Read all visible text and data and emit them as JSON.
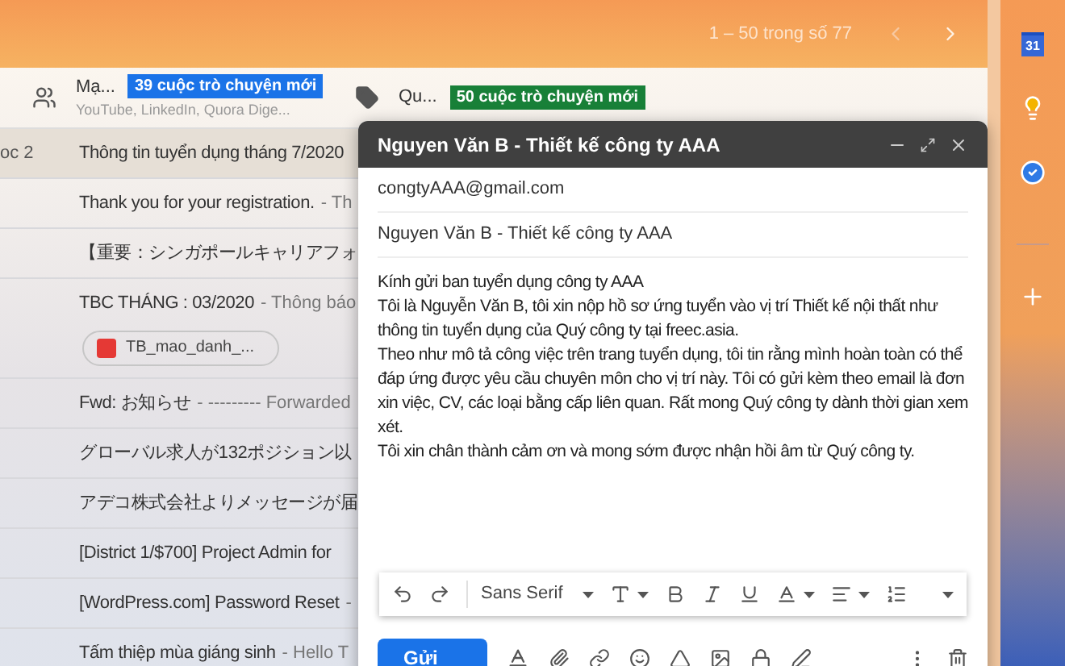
{
  "top_bar": {
    "page_info": "1 – 50 trong số 77"
  },
  "categories": [
    {
      "kind": "social",
      "name": "Mạ...",
      "badge": "39 cuộc trò chuyện mới",
      "color": "#1a73e8",
      "snippet": "YouTube, LinkedIn, Quora Dige..."
    },
    {
      "kind": "promotions",
      "name": "Qu...",
      "badge": "50 cuộc trò chuyện mới",
      "color": "#188038"
    }
  ],
  "emails": [
    {
      "sender": "oc 2",
      "subject": "Thông tin tuyển dụng tháng 7/2020",
      "selected": true
    },
    {
      "subject": "Thank you for your registration.",
      "snippet": "- Th",
      "selected": false
    },
    {
      "subject": "【重要：シンガポールキャリアフォ",
      "selected": false
    },
    {
      "subject": "TBC THÁNG : 03/2020",
      "snippet": "- Thông báo",
      "selected": false,
      "attachment": "TB_mao_danh_..."
    },
    {
      "subject": "Fwd: お知らせ",
      "snippet": "- --------- Forwarded",
      "selected": false
    },
    {
      "subject": "グローバル求人が132ポジション以",
      "selected": false
    },
    {
      "subject": "アデコ株式会社よりメッセージが届",
      "selected": false
    },
    {
      "subject": "[District 1/$700] Project Admin for",
      "selected": false
    },
    {
      "subject": "[WordPress.com] Password Reset",
      "snippet": "-",
      "selected": false
    },
    {
      "subject": "Tấm thiệp mùa giáng sinh",
      "snippet": "- Hello T",
      "selected": false
    }
  ],
  "side_panel": {
    "calendar_day": "31"
  },
  "compose": {
    "title": "Nguyen Văn B - Thiết kế công ty AAA",
    "to": "congtyAAA@gmail.com",
    "subject": "Nguyen Văn B - Thiết kế công ty AAA",
    "body": [
      "Kính gửi ban tuyển dụng công ty AAA",
      "Tôi là Nguyễn Văn B, tôi xin nộp hồ sơ ứng tuyển vào vị trí Thiết kế nội thất như thông tin tuyển dụng của Quý công ty tại freec.asia.",
      "Theo như mô tả công việc trên trang tuyển dụng, tôi tin rằng mình hoàn toàn có thể đáp ứng được yêu cầu chuyên môn cho vị trí này. Tôi có gửi kèm theo email là đơn xin việc, CV, các loại bằng cấp liên quan. Rất mong Quý công ty dành thời gian xem xét.",
      "Tôi xin chân thành cảm ơn và mong sớm được nhận hồi âm từ Quý công ty."
    ],
    "font": "Sans Serif",
    "send": "Gửi"
  }
}
